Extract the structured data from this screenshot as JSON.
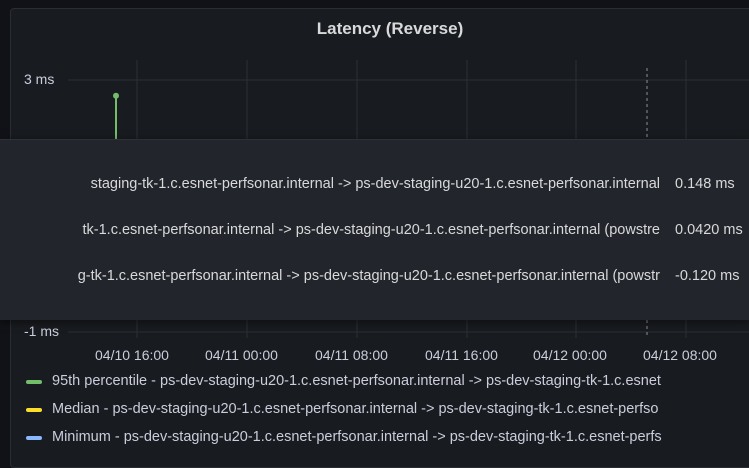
{
  "panel": {
    "title": "Latency (Reverse)"
  },
  "chart_data": {
    "type": "line",
    "title": "Latency (Reverse)",
    "y_ticks": [
      "3 ms",
      "-1 ms"
    ],
    "x_ticks": [
      "04/10 16:00",
      "04/11 00:00",
      "04/11 08:00",
      "04/11 16:00",
      "04/12 00:00",
      "04/12 08:00"
    ],
    "series": [
      {
        "name": "95th percentile - ps-dev-staging-u20-1.c.esnet-perfsonar.internal -> ps-dev-staging-tk-1.c.esnet",
        "color": "#73bf69",
        "points": [
          {
            "x": "04/10 14:00",
            "y": 2.75
          }
        ]
      }
    ]
  },
  "tooltip": {
    "rows": [
      {
        "label": "staging-tk-1.c.esnet-perfsonar.internal -> ps-dev-staging-u20-1.c.esnet-perfsonar.internal",
        "value": "0.148 ms"
      },
      {
        "label": "tk-1.c.esnet-perfsonar.internal -> ps-dev-staging-u20-1.c.esnet-perfsonar.internal (powstre",
        "value": "0.0420 ms"
      },
      {
        "label": "g-tk-1.c.esnet-perfsonar.internal -> ps-dev-staging-u20-1.c.esnet-perfsonar.internal (powstr",
        "value": "-0.120 ms"
      }
    ]
  },
  "legend": {
    "items": [
      {
        "label": "95th percentile - ps-dev-staging-u20-1.c.esnet-perfsonar.internal -> ps-dev-staging-tk-1.c.esnet",
        "color": "#73bf69"
      },
      {
        "label": "Median - ps-dev-staging-u20-1.c.esnet-perfsonar.internal -> ps-dev-staging-tk-1.c.esnet-perfso",
        "color": "#fade2a"
      },
      {
        "label": "Minimum - ps-dev-staging-u20-1.c.esnet-perfsonar.internal -> ps-dev-staging-tk-1.c.esnet-perfs",
        "color": "#8ab8ff"
      }
    ]
  }
}
